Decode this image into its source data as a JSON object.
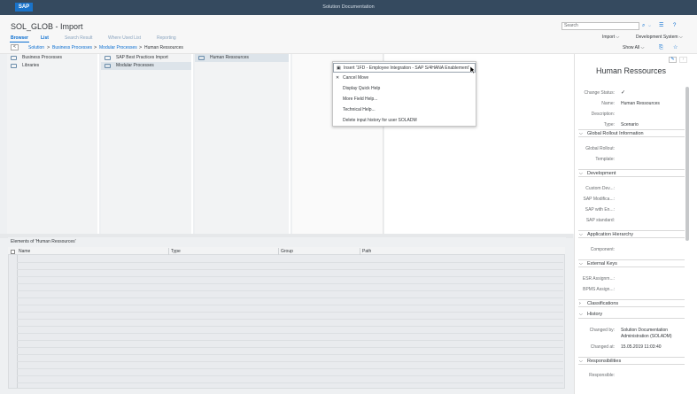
{
  "shell": {
    "logo": "SAP",
    "title": "Solution Documentation"
  },
  "header": {
    "page_title": "SOL_GLOB - Import",
    "search_placeholder": "Search",
    "tabs": [
      {
        "label": "Browser"
      },
      {
        "label": "List"
      },
      {
        "label": "Search Result"
      },
      {
        "label": "Where Used List"
      },
      {
        "label": "Reporting"
      }
    ],
    "import_label": "Import",
    "system_label": "Development System",
    "show_all_label": "Show All",
    "back_label": "<",
    "breadcrumbs": [
      "Solution",
      "Business Processes",
      "Modular Processes",
      "Human Ressources"
    ],
    "separator": ">"
  },
  "columns": [
    {
      "items": [
        "Business Processes",
        "Libraries"
      ]
    },
    {
      "items": [
        "SAP Best Practices Import",
        "Modular Processes"
      ]
    },
    {
      "items": [
        "Human Ressources"
      ]
    }
  ],
  "context_menu": {
    "items": [
      "Insert '1FD - Employee Integration - SAP S/4HANA Enablement'",
      "Cancel Move",
      "Display Quick Help",
      "More Field Help...",
      "Technical Help...",
      "Delete input history for user SOLADM"
    ]
  },
  "elements_table": {
    "title": "Elements of 'Human Ressources'",
    "columns": [
      "Name",
      "Type",
      "Group",
      "Path"
    ]
  },
  "detail": {
    "title": "Human Ressources",
    "fields_top": [
      {
        "label": "Change Status:",
        "value": "✓"
      },
      {
        "label": "Name:",
        "value": "Human Ressources"
      },
      {
        "label": "Description:",
        "value": ""
      },
      {
        "label": "Type:",
        "value": "Scenario"
      }
    ],
    "sections": {
      "global_rollout": "Global Rollout Information",
      "development": "Development",
      "app_hierarchy": "Application Hierarchy",
      "external_keys": "External Keys",
      "classifications": "Classifications",
      "history": "History",
      "responsibilities": "Responsibilities"
    },
    "global_rollout_fields": [
      "Global Rollout:",
      "Template:"
    ],
    "development_fields": [
      "Custom Dev...:",
      "SAP Modifica...:",
      "SAP with En...:",
      "SAP standard:"
    ],
    "app_hierarchy_fields": [
      "Component:"
    ],
    "external_keys_fields": [
      "ESR Assignm...:",
      "BPMS Assign...:"
    ],
    "history_fields": [
      {
        "label": "Changed by:",
        "value": "Solution Documentation",
        "value2": "Administration (SOLADM)"
      },
      {
        "label": "Changed at:",
        "value": "15.05.2019 11:03:40"
      }
    ],
    "responsibilities_fields": [
      "Responsible:"
    ]
  }
}
